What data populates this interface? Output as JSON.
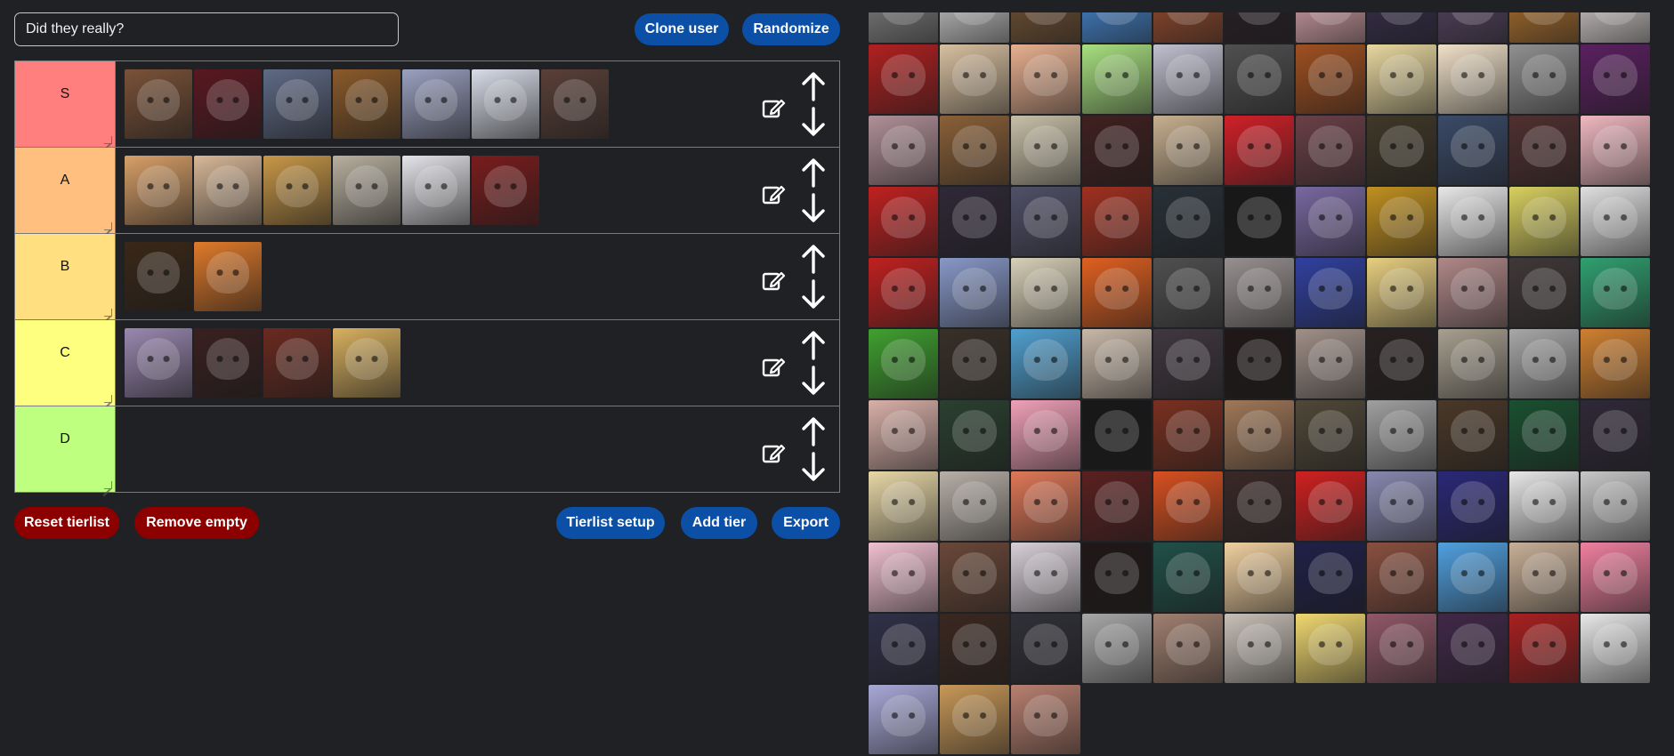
{
  "header": {
    "title_value": "Did they really?",
    "clone_label": "Clone user",
    "randomize_label": "Randomize"
  },
  "tiers": [
    {
      "label": "S",
      "color": "#ff7f7f",
      "items": [
        "#7a5238",
        "#5a1820",
        "#5f6a86",
        "#8a5a2a",
        "#9aa0c0",
        "#d8dce8",
        "#5a4038"
      ]
    },
    {
      "label": "A",
      "color": "#ffbf7f",
      "items": [
        "#d8a068",
        "#d8b898",
        "#c89848",
        "#b8b0a0",
        "#e4e4ea",
        "#7a1c1c"
      ]
    },
    {
      "label": "B",
      "color": "#ffdf7f",
      "items": [
        "#3a2818",
        "#e07a2a"
      ]
    },
    {
      "label": "C",
      "color": "#ffff7f",
      "items": [
        "#9a88b0",
        "#3a2020",
        "#6a2a20",
        "#d8b060"
      ]
    },
    {
      "label": "D",
      "color": "#bfff7f",
      "items": []
    }
  ],
  "footer": {
    "reset_label": "Reset tierlist",
    "remove_empty_label": "Remove empty",
    "setup_label": "Tierlist setup",
    "add_tier_label": "Add tier",
    "export_label": "Export"
  },
  "icons": {
    "edit": "edit-icon",
    "up": "arrow-up-icon",
    "down": "arrow-down-icon"
  },
  "colors": {
    "background": "#202124",
    "button_blue": "#0b4fa6",
    "button_red": "#8c0000"
  },
  "pool": [
    "#8a8a8a",
    "#d8d8d8",
    "#7a5838",
    "#4a90e0",
    "#a05030",
    "#2a2028",
    "#e8b0b8",
    "#3a3050",
    "#5a4868",
    "#b87830",
    "#e8e0e0",
    "#b02020",
    "#d8c0a0",
    "#e8b090",
    "#a8e080",
    "#c0c0d0",
    "#505050",
    "#a05020",
    "#e8d8a0",
    "#f0e0c8",
    "#909090",
    "#5a2060",
    "#b09098",
    "#8a6038",
    "#c8c0a8",
    "#402020",
    "#c8b090",
    "#d02028",
    "#6a4048",
    "#403828",
    "#3a4a68",
    "#503030",
    "#f0b8c0",
    "#c02020",
    "#302838",
    "#505068",
    "#a03020",
    "#283038",
    "#181818",
    "#7868a0",
    "#c09020",
    "#e8e8e8",
    "#d8d060",
    "#e0e0e0",
    "#c02020",
    "#8898c8",
    "#d8d0b8",
    "#e06020",
    "#505050",
    "#989090",
    "#3040a0",
    "#e8d080",
    "#b08888",
    "#403838",
    "#30a070",
    "#40a030",
    "#383028",
    "#50a0d0",
    "#c8b8a8",
    "#403840",
    "#201818",
    "#a09088",
    "#282020",
    "#a8a090",
    "#a8a8a8",
    "#d08030",
    "#d8b0a8",
    "#2a4030",
    "#f0a0b8",
    "#181818",
    "#7a3020",
    "#a07858",
    "#504838",
    "#a0a0a0",
    "#4a3828",
    "#1a5030",
    "#302838",
    "#e8d8a8",
    "#b8b0a8",
    "#e07858",
    "#5a2020",
    "#d85020",
    "#3a2828",
    "#d02020",
    "#8888b0",
    "#2a2878",
    "#e8e8e8",
    "#c8c8c8",
    "#f0c0d0",
    "#6a4838",
    "#d8d0d8",
    "#201818",
    "#205048",
    "#f0d0a0",
    "#202048",
    "#8a5040",
    "#50a0e0",
    "#c8b098",
    "#f080a0",
    "#303048",
    "#3a2820",
    "#303038",
    "#a8a8a8",
    "#a08070",
    "#c8c0b8",
    "#f0d870",
    "#905868",
    "#402848",
    "#a82020",
    "#e8e8e8",
    "#a8a8d8",
    "#c89858",
    "#b88070"
  ]
}
